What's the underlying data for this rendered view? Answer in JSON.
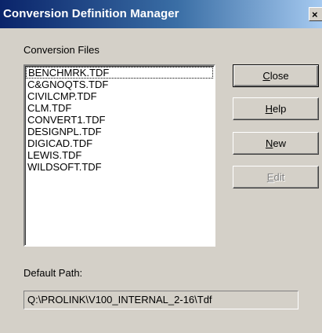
{
  "window": {
    "title": "Conversion Definition Manager",
    "close_glyph": "×"
  },
  "files": {
    "label": "Conversion Files",
    "items": [
      "BENCHMRK.TDF",
      "C&GNOQTS.TDF",
      "CIVILCMP.TDF",
      "CLM.TDF",
      "CONVERT1.TDF",
      "DESIGNPL.TDF",
      "DIGICAD.TDF",
      "LEWIS.TDF",
      "WILDSOFT.TDF"
    ]
  },
  "buttons": {
    "close": {
      "mnemonic": "C",
      "rest": "lose"
    },
    "help": {
      "mnemonic": "H",
      "rest": "elp"
    },
    "new": {
      "mnemonic": "N",
      "rest": "ew"
    },
    "edit": {
      "mnemonic": "E",
      "rest": "dit"
    }
  },
  "default_path": {
    "label": "Default Path:",
    "value": "Q:\\PROLINK\\V100_INTERNAL_2-16\\Tdf"
  },
  "colors": {
    "title_gradient_start": "#0a246a",
    "title_gradient_end": "#a6caf0",
    "face": "#d4d0c8",
    "disabled_text": "#808080"
  }
}
